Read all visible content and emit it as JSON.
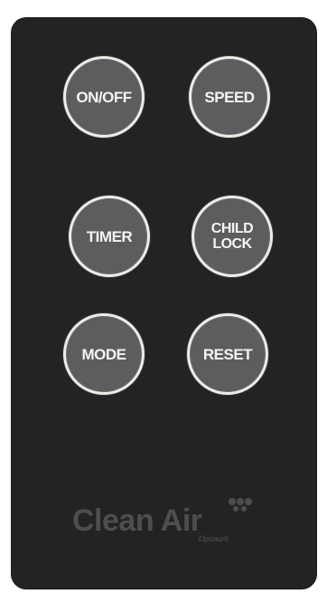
{
  "buttons": {
    "on_off": "ON/OFF",
    "speed": "SPEED",
    "timer": "TIMER",
    "child_lock": "CHILD\nLOCK",
    "mode": "MODE",
    "reset": "RESET"
  },
  "logo": {
    "brand": "Clean Air",
    "sub": "Optima®"
  },
  "colors": {
    "body": "#232324",
    "button_fill": "#5c5d5f",
    "button_ring": "#efece6",
    "logo": "#4d4e50"
  }
}
